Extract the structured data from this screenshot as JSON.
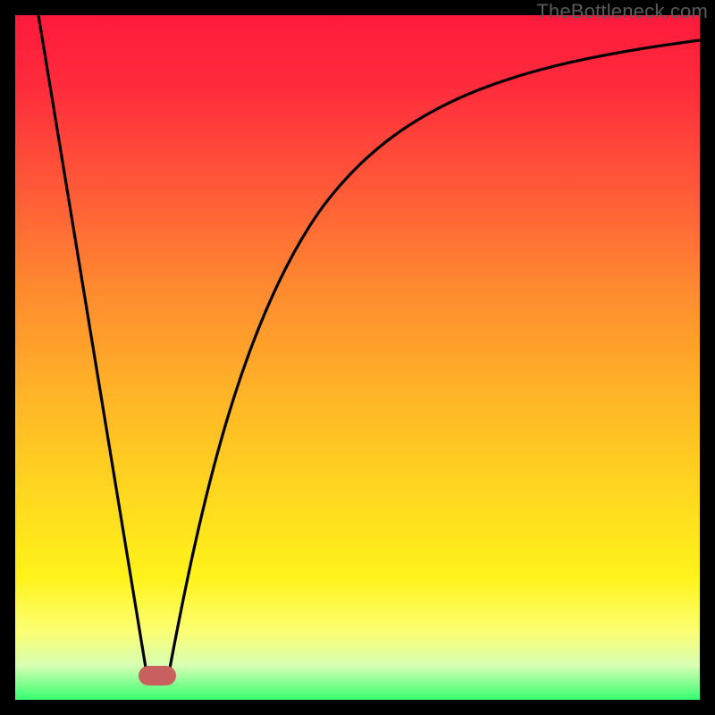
{
  "watermark": {
    "text": "TheBottleneck.com"
  },
  "chart_data": {
    "type": "line",
    "title": "",
    "xlabel": "",
    "ylabel": "",
    "xlim": [
      0,
      100
    ],
    "ylim": [
      0,
      100
    ],
    "grid": false,
    "series": [
      {
        "name": "bottleneck-curve",
        "x": [
          0,
          18,
          20,
          22,
          30,
          40,
          55,
          70,
          85,
          100
        ],
        "values": [
          100,
          6,
          4,
          6,
          40,
          64,
          80,
          88,
          92,
          95
        ]
      }
    ],
    "marker": {
      "x": 20,
      "y": 4,
      "color": "#c86060"
    }
  },
  "colors": {
    "gradient_top": "#ff1a3c",
    "gradient_bottom": "#36ff70",
    "curve": "#000000",
    "marker": "#c86060",
    "frame": "#000000"
  }
}
